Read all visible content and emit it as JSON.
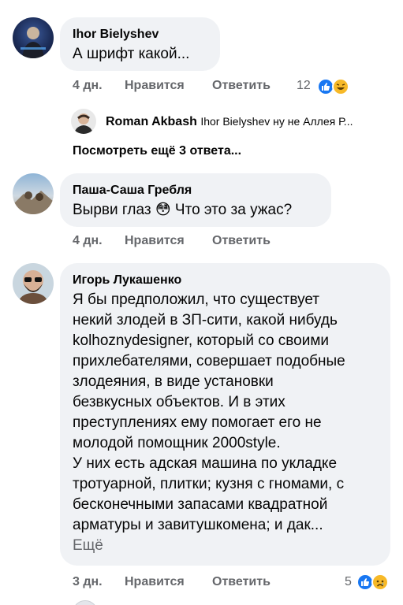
{
  "comments": [
    {
      "author": "Ihor Bielyshev",
      "text": "А шрифт какой...",
      "time": "4 дн.",
      "like_label": "Нравится",
      "reply_label": "Ответить",
      "reaction_count": "12",
      "reactions": [
        "like-icon",
        "haha-icon"
      ]
    },
    {
      "author": "Паша-Саша Гребля",
      "text": "Вырви глаз 😳 Что это за ужас?",
      "time": "4 дн.",
      "like_label": "Нравится",
      "reply_label": "Ответить"
    },
    {
      "author": "Игорь Лукашенко",
      "text_lines": [
        "Я бы предположил, что существует",
        "некий злодей в ЗП-сити, какой нибудь",
        "kolhoznydesigner, который со своими",
        "прихлебателями, совершает подобные",
        "злодеяния, в виде установки",
        "безвкусных объектов. И в этих",
        "преступлениях ему помогает его не",
        "молодой помощник 2000style.",
        "У них есть адская машина по укладке",
        "тротуарной, плитки; кузня с гномами, с",
        "бесконечными запасами квадратной",
        "арматуры и завитушкомена; и дак..."
      ],
      "more_label": "Ещё",
      "time": "3 дн.",
      "like_label": "Нравится",
      "reply_label": "Ответить",
      "reaction_count": "5",
      "reactions": [
        "like-icon",
        "sad-icon"
      ]
    }
  ],
  "reply_preview": {
    "author": "Roman Akbash",
    "text": "Ihor Bielyshev ну не Аллея Р..."
  },
  "view_more_replies": "Посмотреть ещё 3 ответа...",
  "colors": {
    "bubble": "#f0f2f5",
    "meta": "#65676b",
    "like_blue": "#1877f2",
    "haha_yellow": "#f7b928"
  }
}
